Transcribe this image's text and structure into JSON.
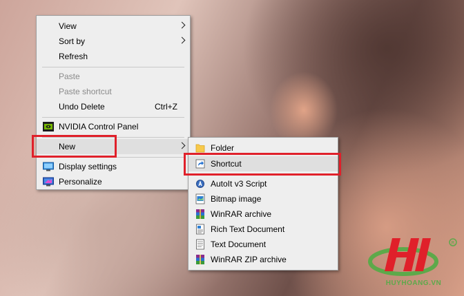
{
  "context_menu": {
    "items": [
      {
        "label": "View",
        "has_submenu": true
      },
      {
        "label": "Sort by",
        "has_submenu": true
      },
      {
        "label": "Refresh"
      },
      {
        "label": "Paste",
        "disabled": true
      },
      {
        "label": "Paste shortcut",
        "disabled": true
      },
      {
        "label": "Undo Delete",
        "shortcut": "Ctrl+Z"
      },
      {
        "label": "NVIDIA Control Panel",
        "icon": "nvidia-icon"
      },
      {
        "label": "New",
        "has_submenu": true,
        "hovered": true
      },
      {
        "label": "Display settings",
        "icon": "display-icon"
      },
      {
        "label": "Personalize",
        "icon": "personalize-icon"
      }
    ]
  },
  "new_submenu": {
    "items": [
      {
        "label": "Folder",
        "icon": "folder-icon"
      },
      {
        "label": "Shortcut",
        "icon": "shortcut-icon",
        "hovered": true
      },
      {
        "label": "AutoIt v3 Script",
        "icon": "autoit-icon"
      },
      {
        "label": "Bitmap image",
        "icon": "bitmap-icon"
      },
      {
        "label": "WinRAR archive",
        "icon": "winrar-icon"
      },
      {
        "label": "Rich Text Document",
        "icon": "rtf-icon"
      },
      {
        "label": "Text Document",
        "icon": "text-document-icon"
      },
      {
        "label": "WinRAR ZIP archive",
        "icon": "winrar-zip-icon"
      }
    ]
  },
  "annotations": {
    "highlight_color": "#e0202a"
  },
  "watermark": {
    "site": "HUYHOANG.VN",
    "brand_colors": [
      "#e0202a",
      "#5da94a"
    ]
  }
}
